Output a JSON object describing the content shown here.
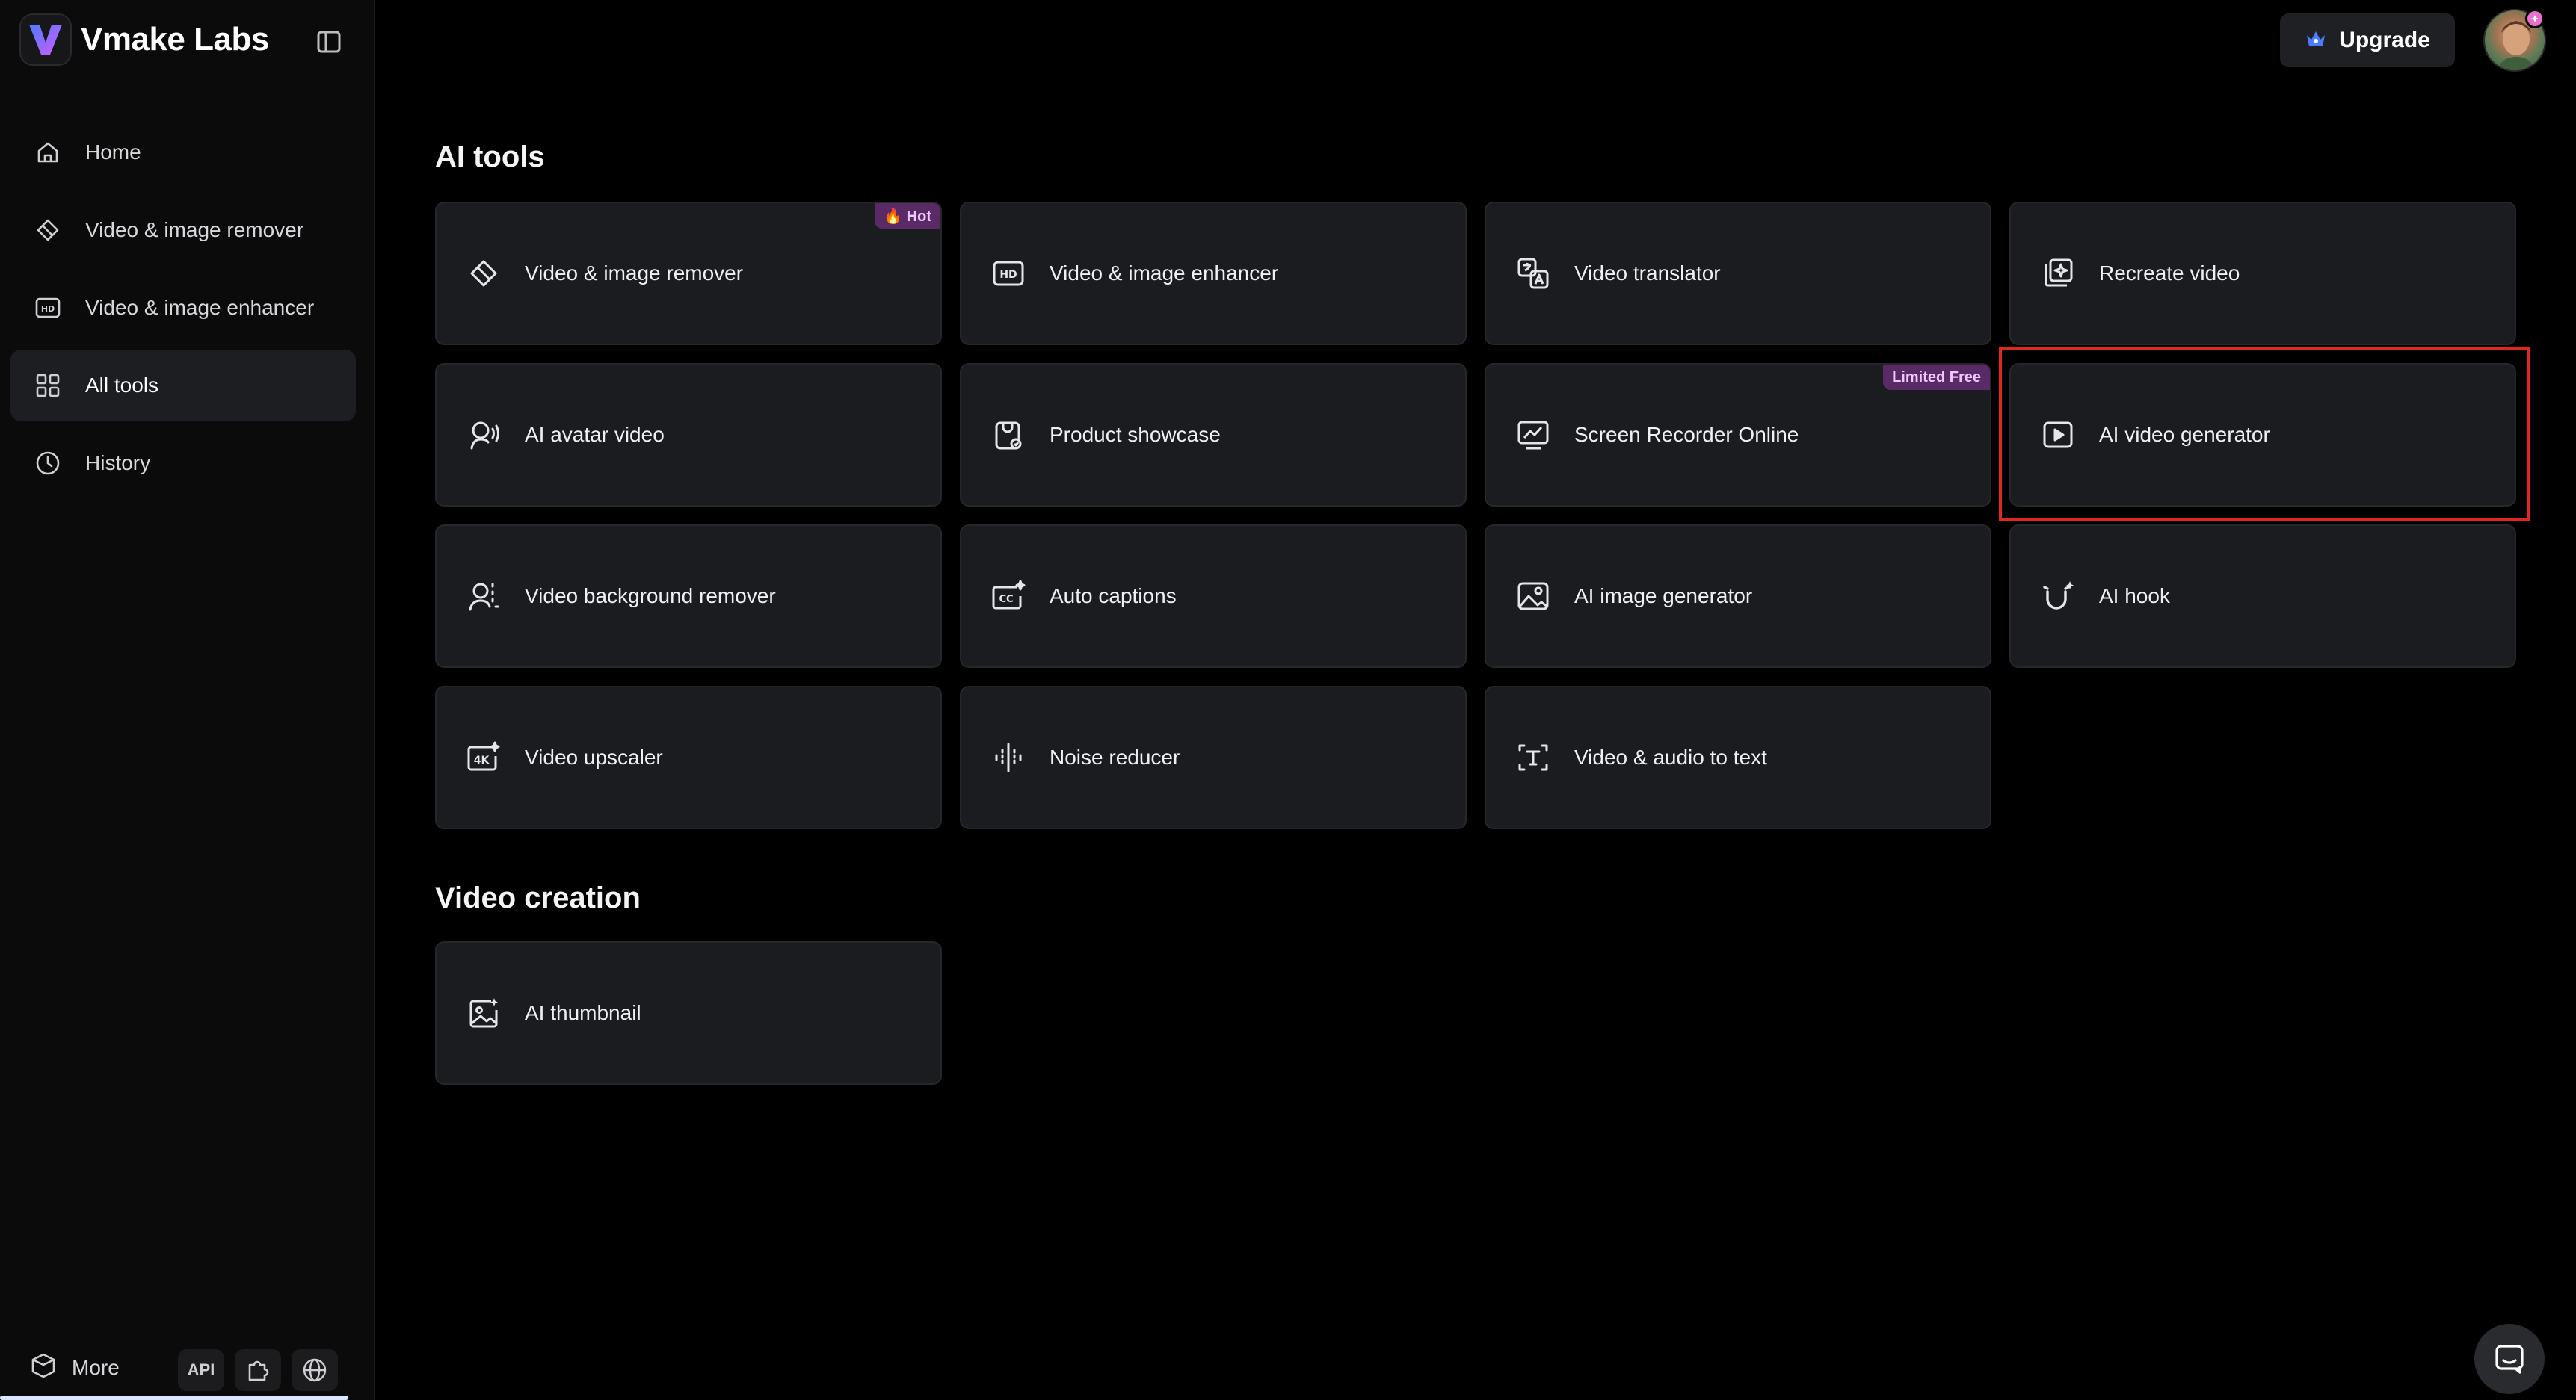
{
  "brand": {
    "name": "Vmake Labs",
    "accent": "#6d5cff"
  },
  "nav": [
    {
      "label": "Home",
      "icon": "home-icon",
      "active": false
    },
    {
      "label": "Video & image remover",
      "icon": "eraser-icon",
      "active": false
    },
    {
      "label": "Video & image enhancer",
      "icon": "hd-icon",
      "active": false
    },
    {
      "label": "All tools",
      "icon": "grid-icon",
      "active": true
    },
    {
      "label": "History",
      "icon": "clock-icon",
      "active": false
    }
  ],
  "footer": {
    "more_label": "More",
    "api_label": "API"
  },
  "topbar": {
    "upgrade_label": "Upgrade"
  },
  "sections": [
    {
      "title": "AI tools",
      "tools": [
        {
          "label": "Video & image remover",
          "icon": "eraser-icon",
          "badge": "🔥 Hot"
        },
        {
          "label": "Video & image enhancer",
          "icon": "hd-icon",
          "badge": ""
        },
        {
          "label": "Video translator",
          "icon": "translate-icon",
          "badge": ""
        },
        {
          "label": "Recreate video",
          "icon": "recreate-icon",
          "badge": ""
        },
        {
          "label": "AI avatar video",
          "icon": "avatar-voice-icon",
          "badge": ""
        },
        {
          "label": "Product showcase",
          "icon": "product-icon",
          "badge": ""
        },
        {
          "label": "Screen Recorder Online",
          "icon": "screen-recorder-icon",
          "badge": "Limited Free"
        },
        {
          "label": "AI video generator",
          "icon": "play-icon",
          "badge": ""
        },
        {
          "label": "Video background remover",
          "icon": "person-cutout-icon",
          "badge": ""
        },
        {
          "label": "Auto captions",
          "icon": "captions-icon",
          "badge": ""
        },
        {
          "label": "AI image generator",
          "icon": "image-icon",
          "badge": ""
        },
        {
          "label": "AI hook",
          "icon": "magnet-icon",
          "badge": ""
        },
        {
          "label": "Video upscaler",
          "icon": "4k-icon",
          "badge": ""
        },
        {
          "label": "Noise reducer",
          "icon": "waveform-icon",
          "badge": ""
        },
        {
          "label": "Video & audio to text",
          "icon": "text-icon",
          "badge": ""
        }
      ]
    },
    {
      "title": "Video creation",
      "tools": [
        {
          "label": "AI thumbnail",
          "icon": "thumbnail-icon",
          "badge": ""
        }
      ]
    }
  ],
  "highlight_color": "#e0261f"
}
